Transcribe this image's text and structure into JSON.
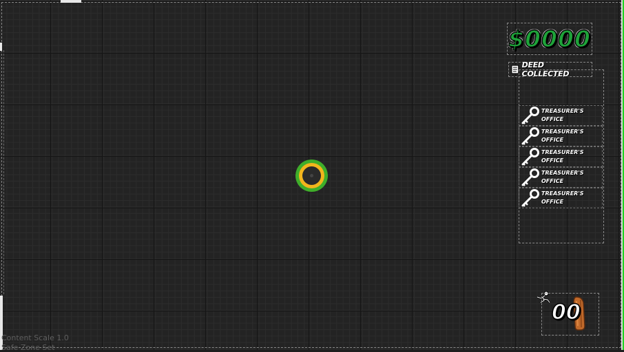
{
  "hud": {
    "money": "$0000",
    "deed_label": "DEED COLLECTED",
    "key_items": [
      {
        "line1": "TREASURER'S",
        "line2": "OFFICE"
      },
      {
        "line1": "TREASURER'S",
        "line2": "OFFICE"
      },
      {
        "line1": "TREASURER'S",
        "line2": "OFFICE"
      },
      {
        "line1": "TREASURER'S",
        "line2": "OFFICE"
      },
      {
        "line1": "TREASURER'S",
        "line2": "OFFICE"
      }
    ],
    "counter": "00"
  },
  "debug": {
    "content_scale": "Content Scale 1.0",
    "safe_zone": "Safe Zone Set"
  },
  "colors": {
    "money_green": "#1fa33a",
    "crosshair_outer": "#3fae2a",
    "crosshair_inner": "#f2b51c",
    "edge_green": "#1fd21f"
  },
  "icons": [
    "deed-icon",
    "key-icon",
    "runner-icon",
    "bat-icon"
  ]
}
